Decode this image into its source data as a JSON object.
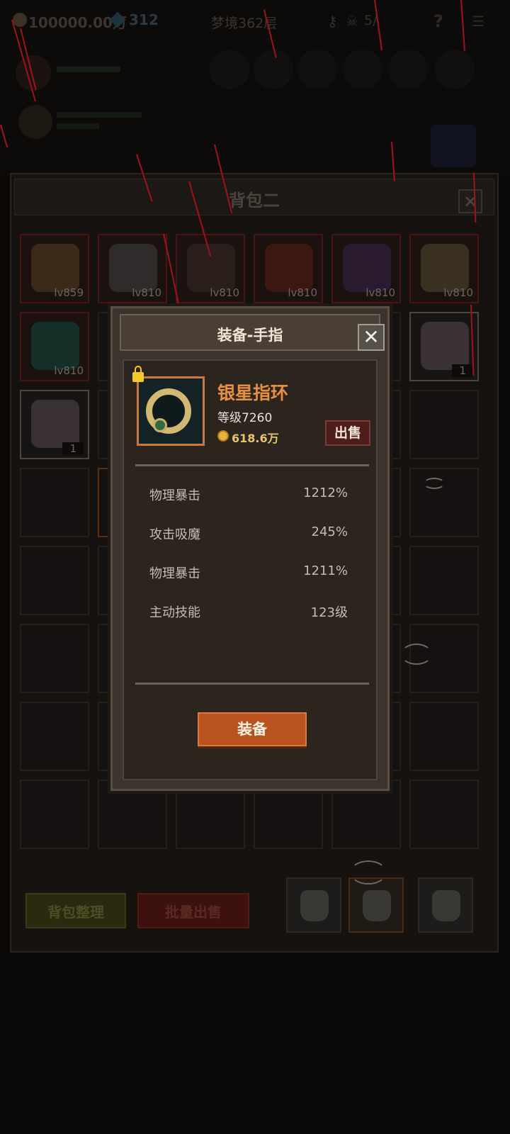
{
  "hud": {
    "gold": "100000.00万",
    "gems": "312",
    "dream_level": "梦境362层",
    "skull_count": "5/",
    "help": "?",
    "icons": [
      "gold-coin-icon",
      "gem-icon",
      "key-icon",
      "skull-icon",
      "help-icon",
      "menu-icon"
    ]
  },
  "bag": {
    "title": "背包二",
    "close": "✕",
    "rows": [
      [
        {
          "level": "lv859",
          "color": "#4a1510",
          "art": "#3a2a1a"
        },
        {
          "level": "lv810",
          "color": "#4a1510",
          "art": "#2e2b2a"
        },
        {
          "level": "lv810",
          "color": "#4a1510",
          "art": "#2a1e1a"
        },
        {
          "level": "lv810",
          "color": "#4a1510",
          "art": "#3a1810"
        },
        {
          "level": "lv810",
          "color": "#4a1510",
          "art": "#2a1a30"
        },
        {
          "level": "lv810",
          "color": "#4a1510",
          "art": "#3a3020"
        }
      ],
      [
        {
          "level": "lv810",
          "color": "#4a1510",
          "art": "#143028"
        },
        {
          "count": "1",
          "color": "#4a4641",
          "art": "#3a3232"
        }
      ],
      [
        {
          "count": "1",
          "color": "#4a4641",
          "art": "#3a3232"
        }
      ]
    ],
    "sort_label": "背包整理",
    "bulk_sell_label": "批量出售",
    "tabs": [
      "bag-tab-1",
      "bag-tab-2",
      "bag-tab-3"
    ],
    "active_tab": 1
  },
  "modal": {
    "title": "装备-手指",
    "close": "✕",
    "item": {
      "name": "银星指环",
      "level": "等级7260",
      "price": "618.6万",
      "locked": true,
      "icon": "ring-icon"
    },
    "sell_label": "出售",
    "stats": [
      {
        "name": "物理暴击",
        "value": "1212%"
      },
      {
        "name": "攻击吸魔",
        "value": "245%"
      },
      {
        "name": "物理暴击",
        "value": "1211%"
      },
      {
        "name": "主动技能",
        "value": "123级"
      }
    ],
    "equip_label": "装备",
    "accent": "#e59040"
  }
}
